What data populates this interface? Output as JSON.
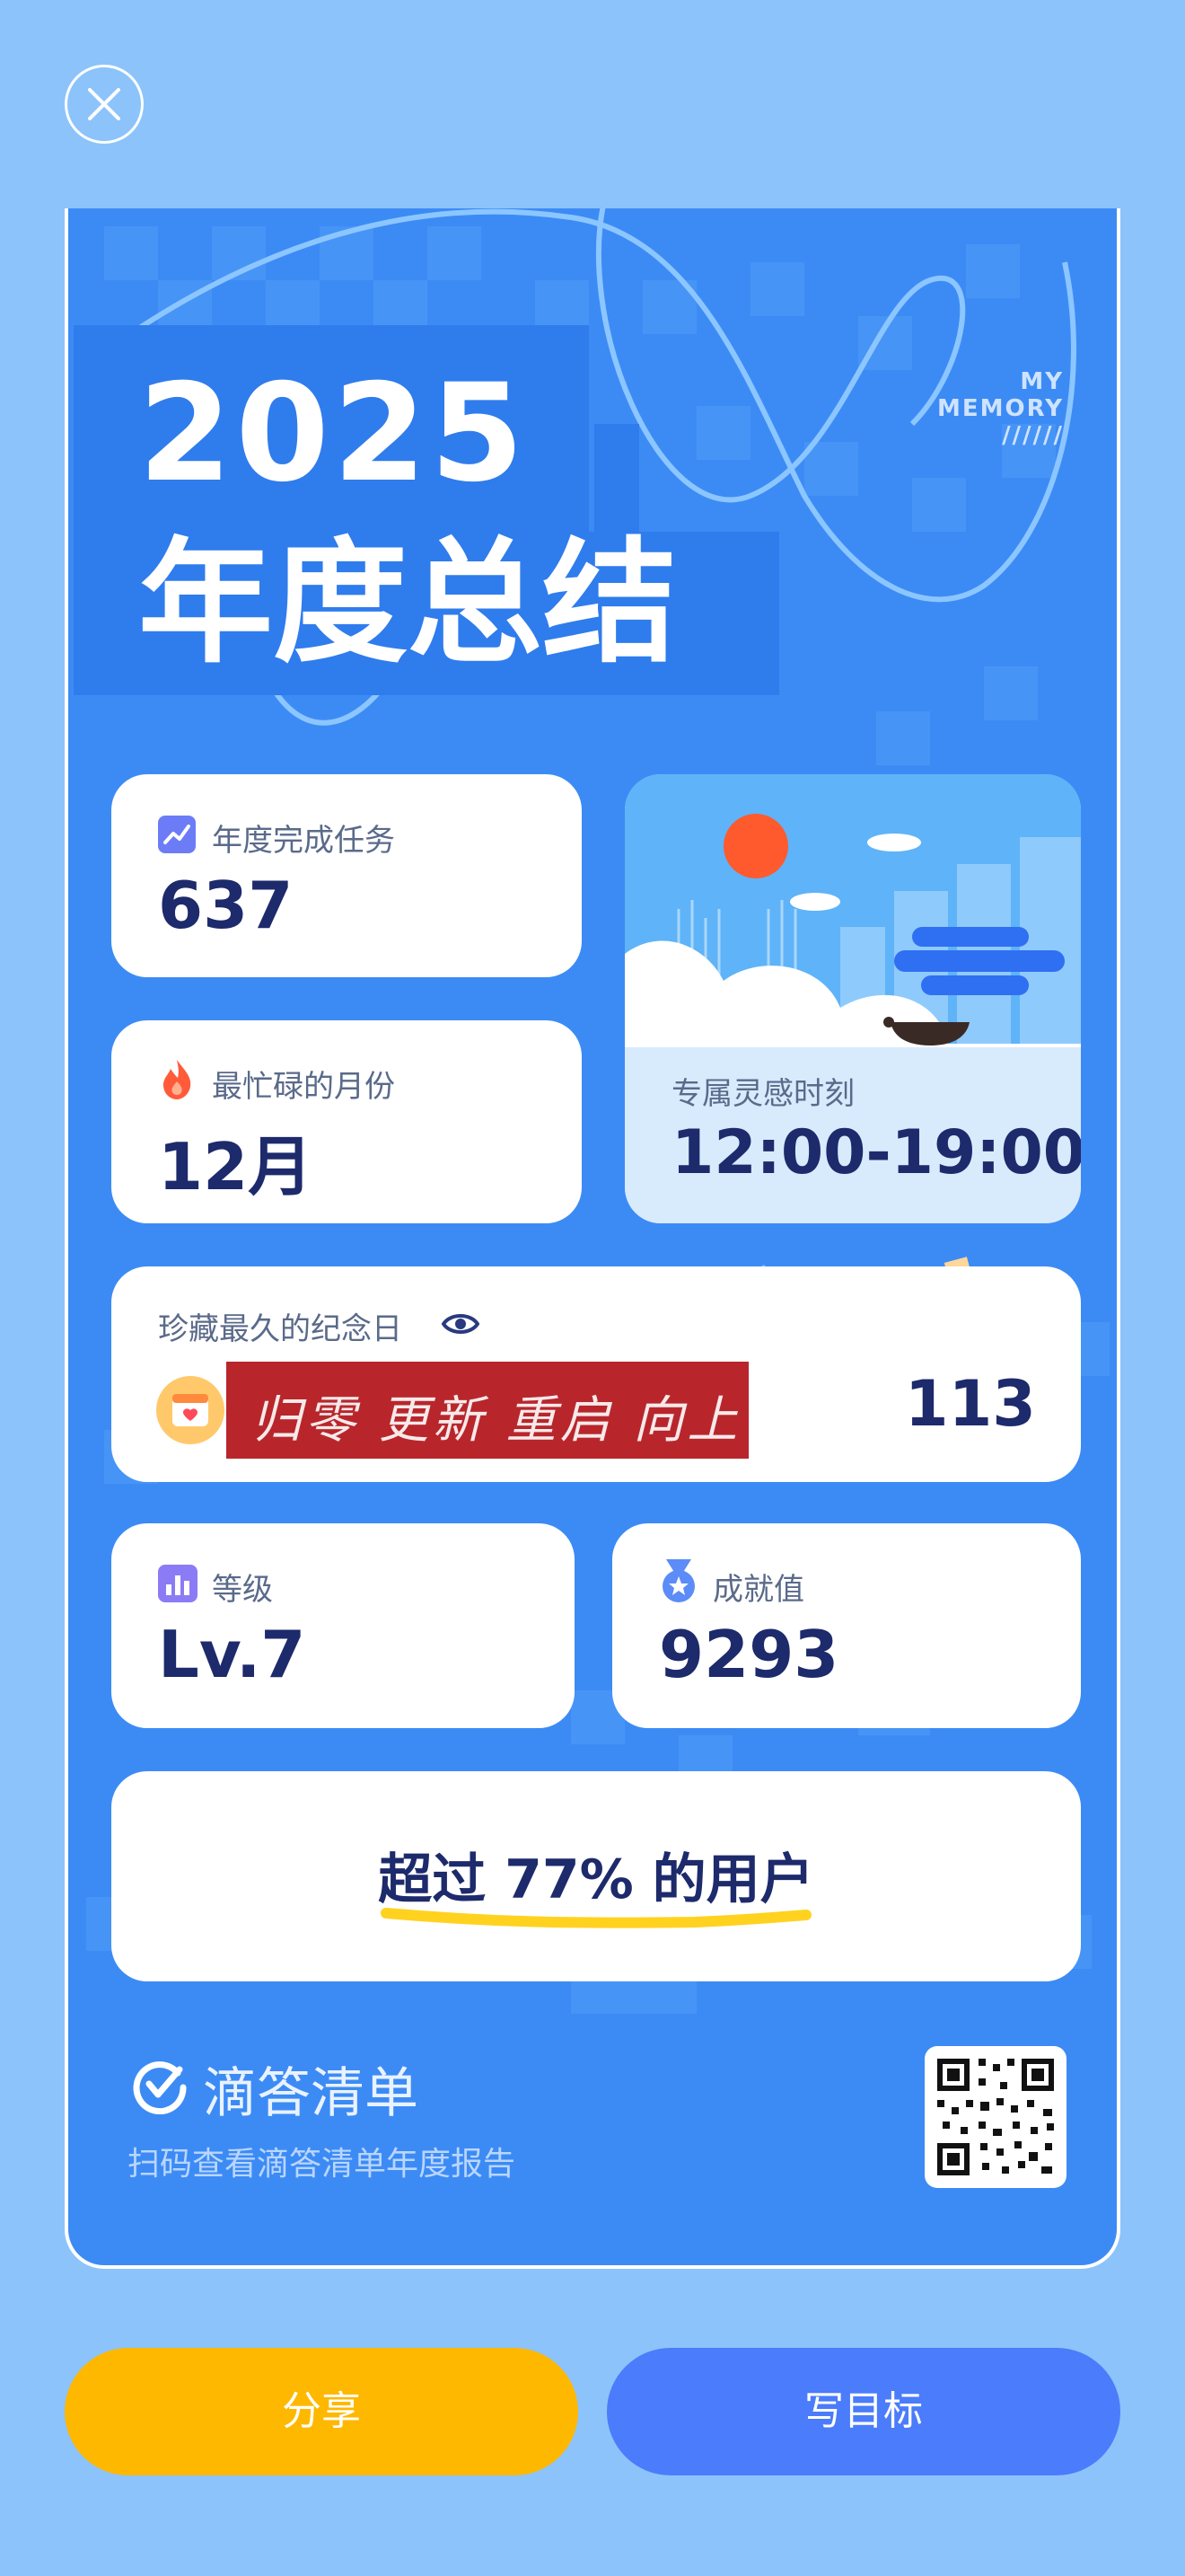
{
  "header": {
    "close_icon": "close-icon"
  },
  "report": {
    "year": "2025",
    "title": "年度总结",
    "memory_tag": [
      "MY",
      "MEMORY",
      "//////"
    ]
  },
  "stats": {
    "tasks": {
      "label": "年度完成任务",
      "value": "637",
      "icon": "trend-chart-icon"
    },
    "busiest_month": {
      "label": "最忙碌的月份",
      "value": "12月",
      "icon": "flame-icon"
    },
    "inspiration": {
      "label": "专属灵感时刻",
      "value": "12:00-19:00"
    },
    "anniversary": {
      "label": "珍藏最久的纪念日",
      "photo_text": "归零 更新 重启 向上",
      "value": "113",
      "icon": "eye-icon"
    },
    "level": {
      "label": "等级",
      "value": "Lv.7",
      "icon": "bar-chart-icon"
    },
    "achievement": {
      "label": "成就值",
      "value": "9293",
      "icon": "medal-icon"
    },
    "beyond": {
      "text": "超过 77% 的用户"
    }
  },
  "footer": {
    "brand_name": "滴答清单",
    "caption": "扫码查看滴答清单年度报告"
  },
  "actions": {
    "share_label": "分享",
    "goal_label": "写目标"
  },
  "colors": {
    "background": "#8cc3fb",
    "card": "#3c8bf5",
    "primary_text": "#1d2a6b",
    "share_button": "#ffb800",
    "goal_button": "#4a7cfb",
    "highlight": "#ffd21f"
  }
}
